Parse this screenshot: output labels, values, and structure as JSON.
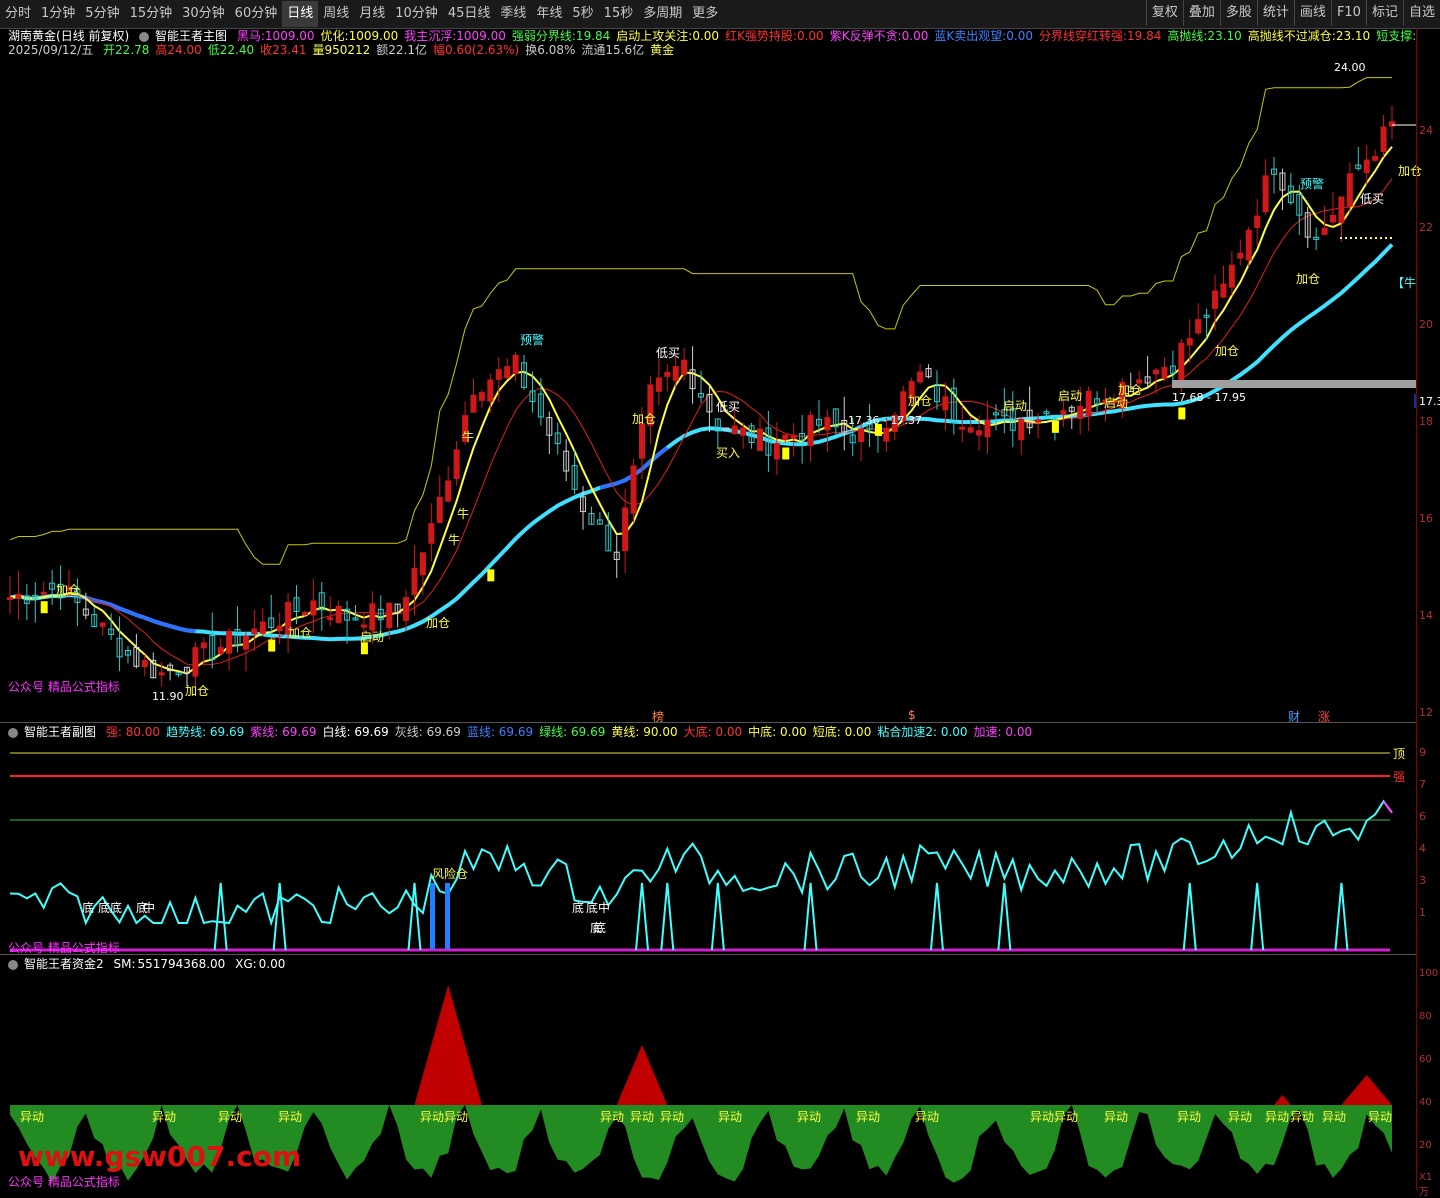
{
  "toolbar": {
    "periods": [
      "分时",
      "1分钟",
      "5分钟",
      "15分钟",
      "30分钟",
      "60分钟",
      "日线",
      "周线",
      "月线",
      "10分钟",
      "45日线",
      "季线",
      "年线",
      "5秒",
      "15秒",
      "多周期",
      "更多"
    ],
    "active": "日线",
    "right": [
      "复权",
      "叠加",
      "多股",
      "统计",
      "画线",
      "F10",
      "标记",
      "自选"
    ]
  },
  "header": {
    "stock": "湖南黄金",
    "mode": "(日线 前复权)",
    "indicator": "智能王者主图",
    "fields": [
      {
        "label": "黑马:",
        "value": "1009.00",
        "color": "#ff40ff"
      },
      {
        "label": "优化:",
        "value": "1009.00",
        "color": "#ffff40"
      },
      {
        "label": "我主沉浮:",
        "value": "1009.00",
        "color": "#ff40ff"
      },
      {
        "label": "强弱分界线:",
        "value": "19.84",
        "color": "#40ff40"
      },
      {
        "label": "启动上攻关注:",
        "value": "0.00",
        "color": "#ffff40"
      },
      {
        "label": "红K强势持股:",
        "value": "0.00",
        "color": "#ff3030"
      },
      {
        "label": "紫K反弹不贪:",
        "value": "0.00",
        "color": "#ff40ff"
      },
      {
        "label": "蓝K卖出观望:",
        "value": "0.00",
        "color": "#4080ff"
      },
      {
        "label": "分界线穿红转强:",
        "value": "19.84",
        "color": "#ff3030"
      },
      {
        "label": "高抛线:",
        "value": "23.10",
        "color": "#40ff40"
      },
      {
        "label": "高抛线不过减仓:",
        "value": "23.10",
        "color": "#ffff40"
      },
      {
        "label": "短支撑:",
        "value": "",
        "color": "#40ff40"
      }
    ],
    "date": "2025/09/12/五",
    "quote": [
      {
        "label": "开",
        "value": "22.78",
        "color": "#40ff40"
      },
      {
        "label": "高",
        "value": "24.00",
        "color": "#ff3030"
      },
      {
        "label": "低",
        "value": "22.40",
        "color": "#40ff40"
      },
      {
        "label": "收",
        "value": "23.41",
        "color": "#ff3030"
      },
      {
        "label": "量",
        "value": "950212",
        "color": "#ffff40"
      },
      {
        "label": "额",
        "value": "22.1亿",
        "color": "#cccccc"
      },
      {
        "label": "幅",
        "value": "0.60(2.63%)",
        "color": "#ff3030"
      },
      {
        "label": "换",
        "value": "6.08%",
        "color": "#cccccc"
      },
      {
        "label": "流通",
        "value": "15.6亿",
        "color": "#cccccc"
      },
      {
        "label": "",
        "value": "黄金",
        "color": "#ffff40"
      }
    ]
  },
  "main_labels": {
    "high_price": "24.00",
    "low_price": "11.90",
    "range1": "17.36 - 17.37",
    "range2": "17.68 - 17.95",
    "right_tag": "17.3",
    "gongzhonghao": "公众号 精品公式指标",
    "marks": [
      {
        "t": "加仓",
        "c": "#ffff40"
      },
      {
        "t": "加仓",
        "c": "#ffff40"
      },
      {
        "t": "加仓",
        "c": "#ffff40"
      },
      {
        "t": "加仓",
        "c": "#ffff40"
      },
      {
        "t": "加仓",
        "c": "#ffff40"
      },
      {
        "t": "加仓",
        "c": "#ffff40"
      },
      {
        "t": "加仓",
        "c": "#ffff40"
      },
      {
        "t": "加仓",
        "c": "#ffff40"
      },
      {
        "t": "加仓",
        "c": "#ffff40"
      },
      {
        "t": "加仓",
        "c": "#ffff40"
      },
      {
        "t": "启动",
        "c": "#ffff40"
      },
      {
        "t": "启动",
        "c": "#ffff40"
      },
      {
        "t": "启动",
        "c": "#ffff40"
      },
      {
        "t": "启动",
        "c": "#ffff40"
      },
      {
        "t": "牛",
        "c": "#ffff40"
      },
      {
        "t": "牛",
        "c": "#ffff40"
      },
      {
        "t": "牛",
        "c": "#ffff40"
      },
      {
        "t": "预警",
        "c": "#40ffff"
      },
      {
        "t": "预警",
        "c": "#40ffff"
      },
      {
        "t": "低买",
        "c": "#ffffff"
      },
      {
        "t": "低买",
        "c": "#ffffff"
      },
      {
        "t": "低买",
        "c": "#ffffff"
      },
      {
        "t": "买入",
        "c": "#ffff40"
      },
      {
        "t": "【牛",
        "c": "#40ffff"
      },
      {
        "t": "榜",
        "c": "#ff8040"
      },
      {
        "t": "$",
        "c": "#ff8040"
      },
      {
        "t": "财",
        "c": "#40a0ff"
      },
      {
        "t": "涨",
        "c": "#ff4040"
      }
    ]
  },
  "price_axis": [
    "24",
    "22",
    "20",
    "18",
    "16",
    "14",
    "12"
  ],
  "sub": {
    "title": "智能王者副图",
    "fields": [
      {
        "label": "强:",
        "value": "80.00",
        "color": "#ff3030"
      },
      {
        "label": "趋势线:",
        "value": "69.69",
        "color": "#40ffff"
      },
      {
        "label": "紫线:",
        "value": "69.69",
        "color": "#ff40ff"
      },
      {
        "label": "白线:",
        "value": "69.69",
        "color": "#ffffff"
      },
      {
        "label": "灰线:",
        "value": "69.69",
        "color": "#cccccc"
      },
      {
        "label": "蓝线:",
        "value": "69.69",
        "color": "#4080ff"
      },
      {
        "label": "绿线:",
        "value": "69.69",
        "color": "#40ff40"
      },
      {
        "label": "黄线:",
        "value": "90.00",
        "color": "#ffff40"
      },
      {
        "label": "大底:",
        "value": "0.00",
        "color": "#ff3030"
      },
      {
        "label": "中底:",
        "value": "0.00",
        "color": "#ffff40"
      },
      {
        "label": "短底:",
        "value": "0.00",
        "color": "#ffff40"
      },
      {
        "label": "粘合加速2:",
        "value": "0.00",
        "color": "#40ffff"
      },
      {
        "label": "加速:",
        "value": "0.00",
        "color": "#ff40ff"
      }
    ],
    "top_label": "顶",
    "strong_label": "强",
    "wind_label": "风险仓",
    "gongzhonghao": "公众号 精品公式指标",
    "bottom_marks": [
      "底",
      "底",
      "底",
      "底",
      "中",
      "底",
      "底",
      "底",
      "中",
      "底"
    ],
    "axis": [
      "9",
      "7",
      "6",
      "4",
      "3",
      "1"
    ]
  },
  "capital": {
    "title": "智能王者资金2",
    "sm_label": "SM:",
    "sm_value": "551794368.00",
    "xg_label": "XG:",
    "xg_value": "0.00",
    "yidong": "异动",
    "axis": [
      "100",
      "80",
      "60",
      "40",
      "20"
    ],
    "unit": "X1万",
    "gongzhonghao": "公众号 精品公式指标"
  },
  "watermark": "www.gsw007.com",
  "colors": {
    "up": "#ff3030",
    "down": "#40ffff",
    "ma_yellow": "#ffff40",
    "band": "#c8c800",
    "cyan_line": "#40e0ff",
    "blue_line": "#3070ff",
    "green_area": "#228b22",
    "red_area": "#c00000"
  }
}
